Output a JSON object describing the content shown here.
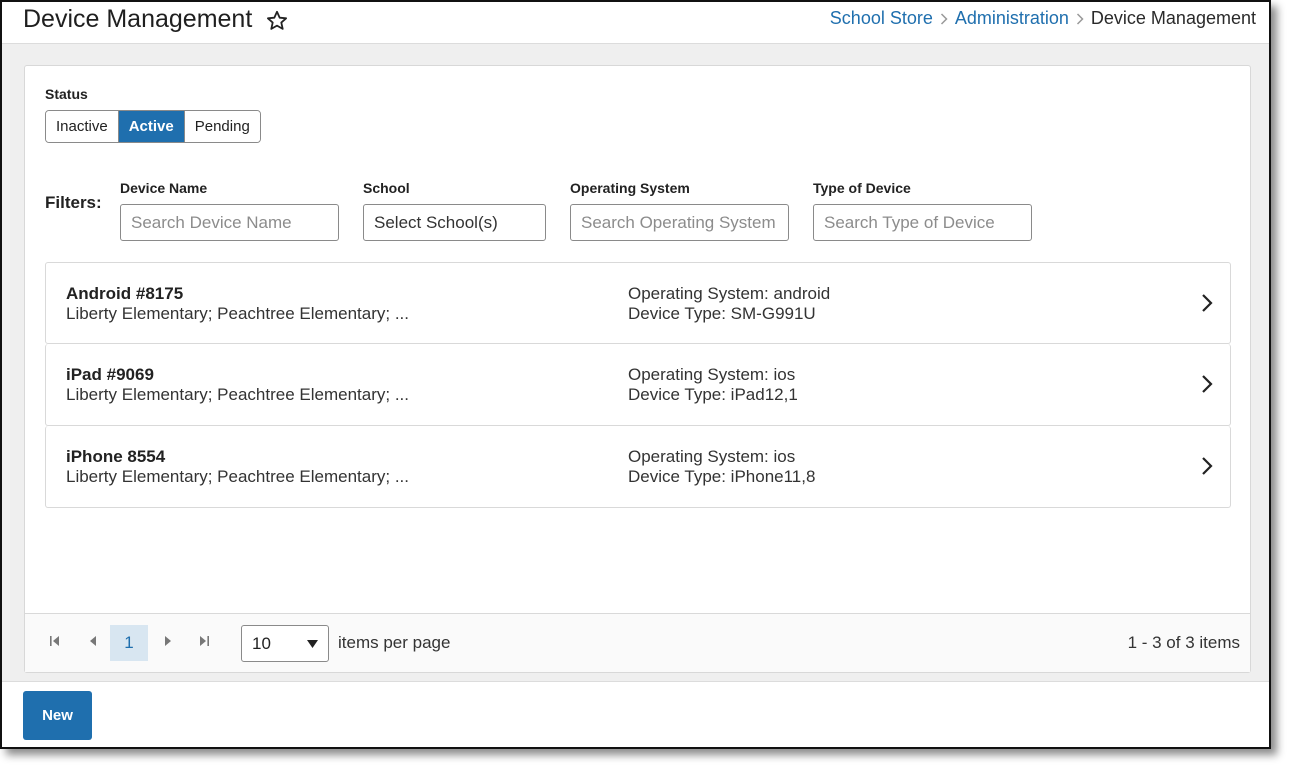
{
  "header": {
    "title": "Device Management",
    "breadcrumb": [
      "School Store",
      "Administration",
      "Device Management"
    ]
  },
  "status": {
    "label": "Status",
    "options": [
      "Inactive",
      "Active",
      "Pending"
    ],
    "selected": "Active"
  },
  "filters": {
    "label": "Filters:",
    "device_name": {
      "label": "Device Name",
      "placeholder": "Search Device Name"
    },
    "school": {
      "label": "School",
      "placeholder": "Select School(s)"
    },
    "operating_system": {
      "label": "Operating System",
      "placeholder": "Search Operating System"
    },
    "type_of_device": {
      "label": "Type of Device",
      "placeholder": "Search Type of Device"
    }
  },
  "devices": [
    {
      "name": "Android #8175",
      "schools": "Liberty Elementary; Peachtree Elementary; ...",
      "os": "Operating System: android",
      "type": "Device Type: SM-G991U"
    },
    {
      "name": "iPad #9069",
      "schools": "Liberty Elementary; Peachtree Elementary; ...",
      "os": "Operating System: ios",
      "type": "Device Type: iPad12,1"
    },
    {
      "name": "iPhone 8554",
      "schools": "Liberty Elementary; Peachtree Elementary; ...",
      "os": "Operating System: ios",
      "type": "Device Type: iPhone11,8"
    }
  ],
  "pager": {
    "current_page": "1",
    "per_page": "10",
    "per_page_label": "items per page",
    "summary": "1 - 3 of 3 items"
  },
  "footer": {
    "new_label": "New"
  },
  "colors": {
    "accent": "#1f6fae",
    "pager_current_bg": "#d8e6f1"
  }
}
